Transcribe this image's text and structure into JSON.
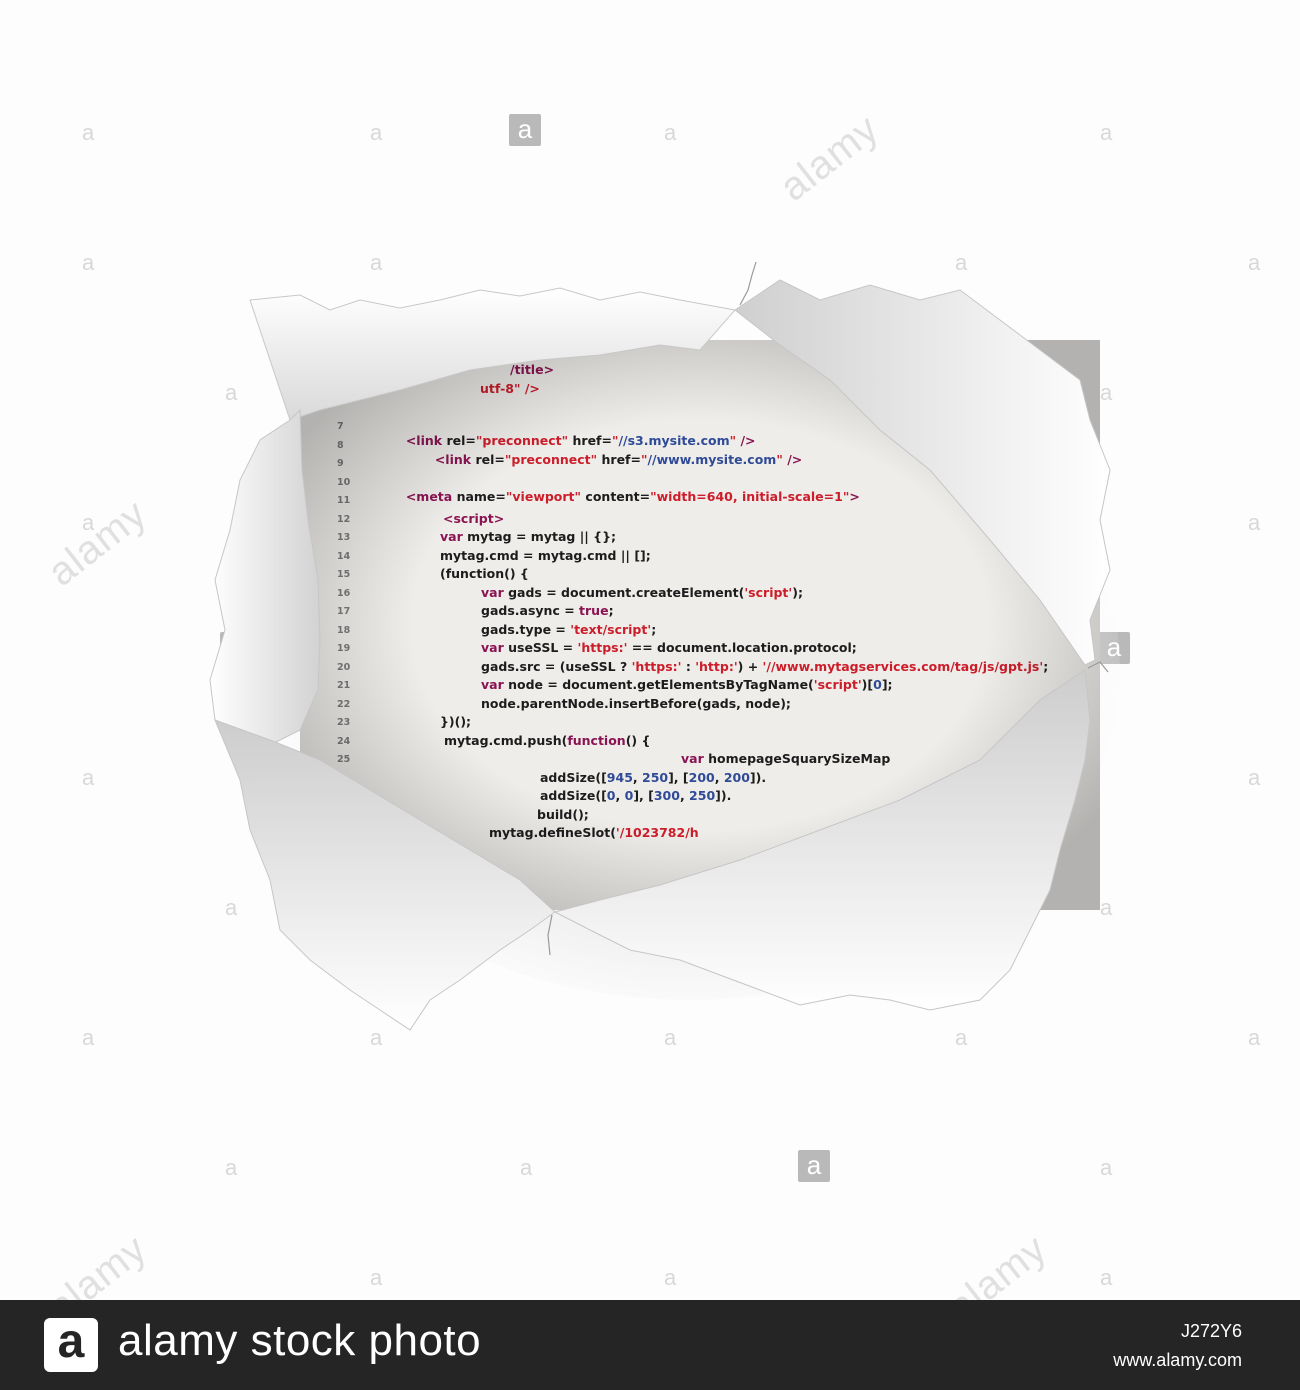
{
  "watermark": {
    "letter": "a",
    "word": "alamy"
  },
  "code": {
    "partial_lines": [
      {
        "text": "/title>"
      },
      {
        "text": "utf-8\" />"
      }
    ],
    "lines": [
      {
        "num": "7",
        "text": "<link rel=\"preconnect\" href=\"//s3.mysite.com\" />"
      },
      {
        "num": "8",
        "text": "<link rel=\"preconnect\" href=\"//www.mysite.com\" />"
      },
      {
        "num": "9",
        "text": ""
      },
      {
        "num": "10",
        "text": "<meta name=\"viewport\" content=\"width=640, initial-scale=1\">"
      },
      {
        "num": "11",
        "text": ""
      },
      {
        "num": "12",
        "text": "<script>"
      },
      {
        "num": "13",
        "text": "var mytag = mytag || {};"
      },
      {
        "num": "14",
        "text": "mytag.cmd = mytag.cmd || [];"
      },
      {
        "num": "15",
        "text": "(function() {"
      },
      {
        "num": "16",
        "text": "var gads = document.createElement('script');"
      },
      {
        "num": "17",
        "text": "gads.async = true;"
      },
      {
        "num": "18",
        "text": "gads.type = 'text/script';"
      },
      {
        "num": "19",
        "text": "var useSSL = 'https:' == document.location.protocol;"
      },
      {
        "num": "20",
        "text": "gads.src = (useSSL ? 'https:' : 'http:') + '//www.mytagservices.com/tag/js/gpt.js';"
      },
      {
        "num": "21",
        "text": "var node = document.getElementsByTagName('script')[0];"
      },
      {
        "num": "22",
        "text": "node.parentNode.insertBefore(gads, node);"
      },
      {
        "num": "23",
        "text": "})();"
      },
      {
        "num": "24",
        "text": "mytag.cmd.push(function() {"
      },
      {
        "num": "25",
        "text": "var homepageSquarySizeMap"
      },
      {
        "num": "",
        "text": "addSize([945, 250], [200, 200])."
      },
      {
        "num": "",
        "text": "addSize([0, 0], [300, 250])."
      },
      {
        "num": "",
        "text": "build();"
      },
      {
        "num": "",
        "text": "mytag.defineSlot('/1023782/h"
      }
    ]
  },
  "banner": {
    "logo_letter": "a",
    "brand": "alamy stock photo",
    "image_id": "J272Y6",
    "site": "www.alamy.com"
  },
  "colors": {
    "tag": "#8a1452",
    "string": "#cc1d2a",
    "url": "#2f4a96",
    "banner_bg": "#252525"
  }
}
